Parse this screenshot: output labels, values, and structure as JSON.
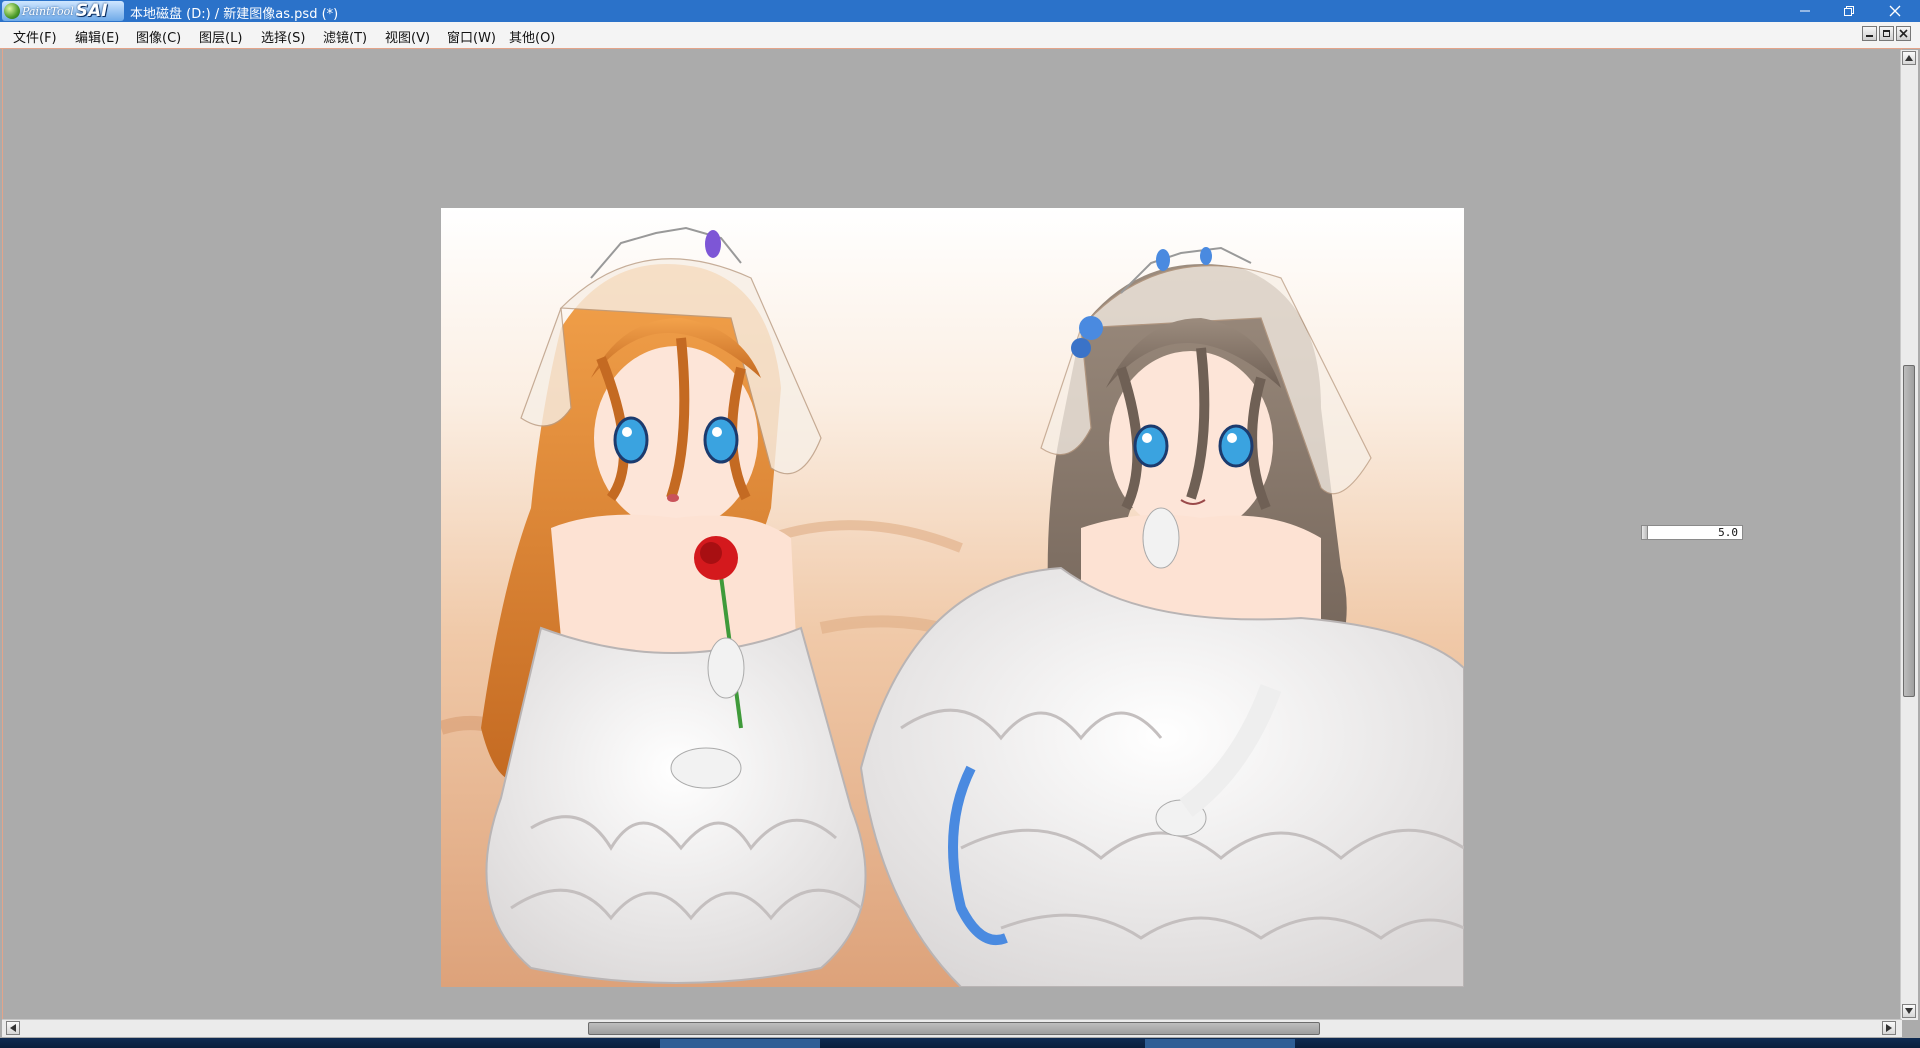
{
  "titlebar": {
    "logo_small": "PaintTool",
    "logo_big": "SAI",
    "title": "本地磁盘 (D:) / 新建图像as.psd (*)",
    "controls": [
      "minimize-icon",
      "restore-icon",
      "close-icon"
    ]
  },
  "menubar": {
    "items": [
      "文件(F)",
      "编辑(E)",
      "图像(C)",
      "图层(L)",
      "选择(S)",
      "滤镜(T)",
      "视图(V)",
      "窗口(W)",
      "其他(O)"
    ],
    "mdi_controls": [
      "minimize-icon",
      "restore-icon",
      "close-icon"
    ]
  },
  "canvas": {
    "description_icon": "artwork-image"
  },
  "zoom": {
    "value": "5.0"
  },
  "scrollbars": {
    "vertical": {
      "position": 0.33,
      "visible_fraction": 0.35
    },
    "horizontal": {
      "position": 0.45,
      "visible_fraction": 0.39
    }
  },
  "colors": {
    "titlebar": "#2b72c9",
    "workspace": "#ababab",
    "accent_border": "#e3a48a"
  }
}
